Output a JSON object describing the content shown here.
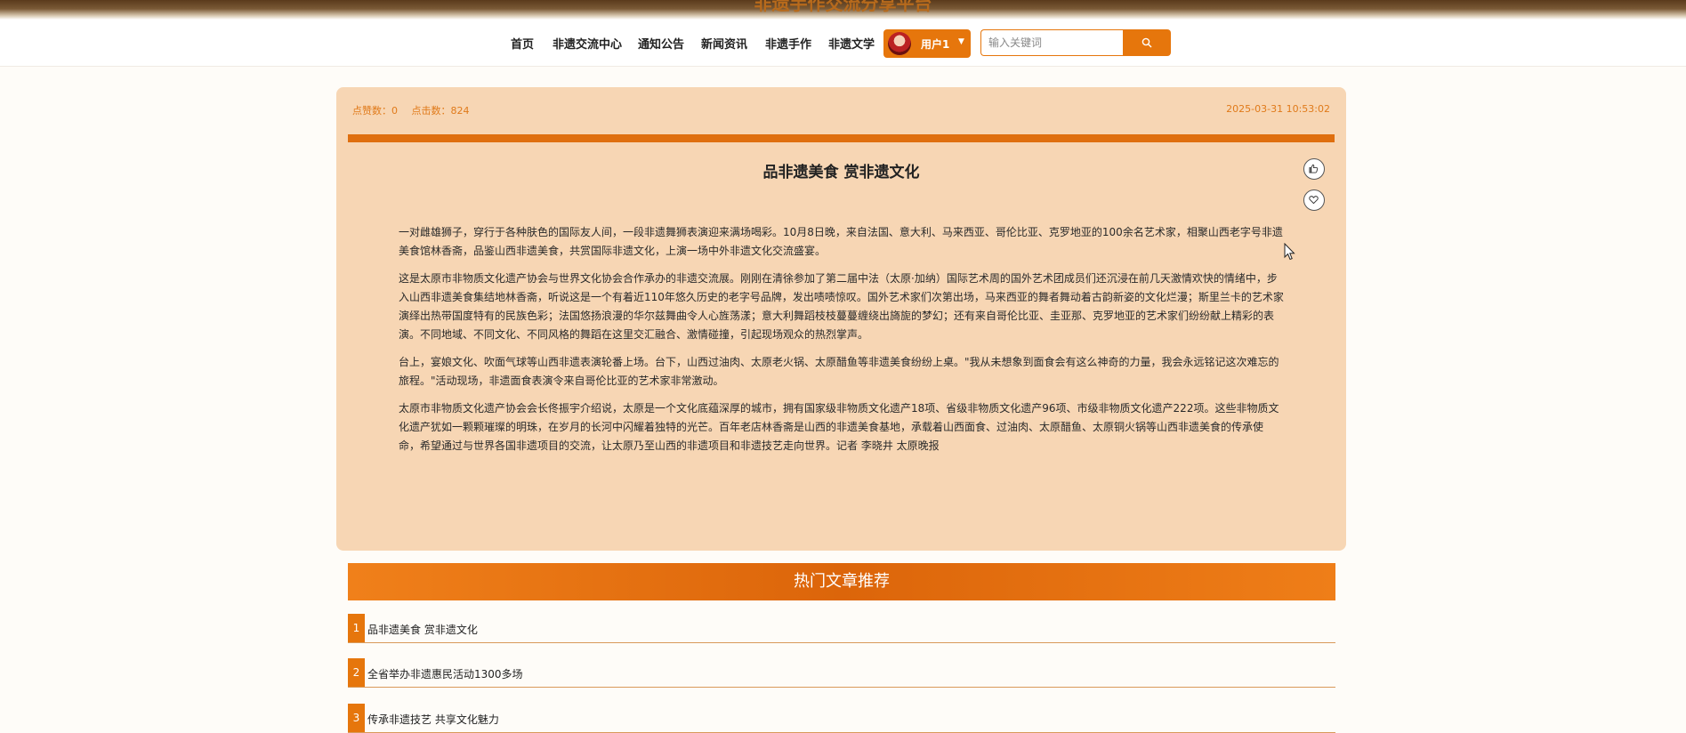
{
  "site": {
    "title": "非遗手作交流分享平台"
  },
  "nav": {
    "items": [
      "首页",
      "非遗交流中心",
      "通知公告",
      "新闻资讯",
      "非遗手作",
      "非遗文学"
    ],
    "user_label": "用户1",
    "search_placeholder": "输入关键词"
  },
  "article": {
    "likes_label": "点赞数：0",
    "clicks_label": "点击数：824",
    "datetime": "2025-03-31 10:53:02",
    "title": "品非遗美食 赏非遗文化",
    "paragraphs": [
      "一对雌雄狮子，穿行于各种肤色的国际友人间，一段非遗舞狮表演迎来满场喝彩。10月8日晚，来自法国、意大利、马来西亚、哥伦比亚、克罗地亚的100余名艺术家，相聚山西老字号非遗美食馆林香斋，品鉴山西非遗美食，共赏国际非遗文化，上演一场中外非遗文化交流盛宴。",
      "这是太原市非物质文化遗产协会与世界文化协会合作承办的非遗交流展。刚刚在清徐参加了第二届中法（太原·加纳）国际艺术周的国外艺术团成员们还沉浸在前几天激情欢快的情绪中，步入山西非遗美食集结地林香斋，听说这是一个有着近110年悠久历史的老字号品牌，发出啧啧惊叹。国外艺术家们次第出场，马来西亚的舞者舞动着古韵新姿的文化烂漫；斯里兰卡的艺术家演绎出热带国度特有的民族色彩；法国悠扬浪漫的华尔兹舞曲令人心旌荡漾；意大利舞蹈枝枝蔓蔓缠绕出旖旎的梦幻；还有来自哥伦比亚、圭亚那、克罗地亚的艺术家们纷纷献上精彩的表演。不同地域、不同文化、不同风格的舞蹈在这里交汇融合、激情碰撞，引起现场观众的热烈掌声。",
      "台上，宴娘文化、吹面气球等山西非遗表演轮番上场。台下，山西过油肉、太原老火锅、太原醋鱼等非遗美食纷纷上桌。\"我从未想象到面食会有这么神奇的力量，我会永远铭记这次难忘的旅程。\"活动现场，非遗面食表演令来自哥伦比亚的艺术家非常激动。",
      "太原市非物质文化遗产协会会长佟振宇介绍说，太原是一个文化底蕴深厚的城市，拥有国家级非物质文化遗产18项、省级非物质文化遗产96项、市级非物质文化遗产222项。这些非物质文化遗产犹如一颗颗璀璨的明珠，在岁月的长河中闪耀着独特的光芒。百年老店林香斋是山西的非遗美食基地，承载着山西面食、过油肉、太原醋鱼、太原铜火锅等山西非遗美食的传承使命，希望通过与世界各国非遗项目的交流，让太原乃至山西的非遗项目和非遗技艺走向世界。记者 李晓井 太原晚报"
    ]
  },
  "hot": {
    "header": "热门文章推荐",
    "items": [
      {
        "num": "1",
        "title": "品非遗美食 赏非遗文化"
      },
      {
        "num": "2",
        "title": "全省举办非遗惠民活动1300多场"
      },
      {
        "num": "3",
        "title": "传承非遗技艺 共享文化魅力"
      }
    ]
  },
  "colors": {
    "accent": "#e6760c",
    "card_bg": "#f7d6b4",
    "meta_text": "#e07a1a"
  }
}
